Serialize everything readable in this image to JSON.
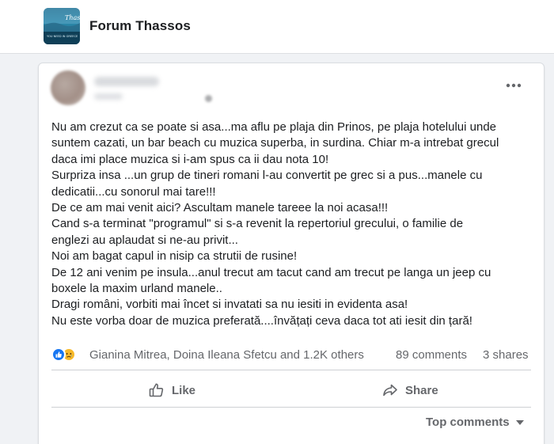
{
  "group": {
    "name": "Forum Thassos",
    "logo_caption": "YOU NEED IN GREECE",
    "logo_script": "Thassos"
  },
  "post": {
    "more_icon": "more-horizontal-icon",
    "lines": [
      "Nu am crezut ca se poate si asa...ma aflu pe plaja din Prinos, pe plaja hotelului unde",
      "suntem cazati, un bar beach cu muzica superba, in surdina. Chiar m-a intrebat grecul",
      "daca imi place muzica si i-am spus ca ii dau nota 10!",
      "Surpriza insa  ...un grup de tineri romani l-au convertit pe grec si a pus...manele cu",
      "dedicatii...cu sonorul mai tare!!!",
      "De ce am mai venit aici? Ascultam manele tareee la noi acasa!!!",
      "Cand s-a terminat \"programul\" si s-a revenit la repertoriul grecului, o familie de",
      "englezi au aplaudat si ne-au privit...",
      "Noi am bagat capul in nisip ca strutii de rusine!",
      "De 12 ani venim pe insula...anul trecut am tacut cand am trecut pe langa un jeep cu",
      "boxele la maxim urland manele..",
      "Dragi români, vorbiti mai încet si invatati sa nu iesiti in evidenta asa!",
      "Nu este vorba doar de muzica preferată....învățați ceva daca tot ati iesit din țară!"
    ],
    "reactions": {
      "names": "Gianina Mitrea, Doina Ileana Sfetcu and 1.2K others",
      "comments": "89 comments",
      "shares": "3 shares",
      "icons": [
        "like-reaction-icon",
        "sad-reaction-icon"
      ]
    },
    "actions": {
      "like": "Like",
      "share": "Share"
    },
    "sort_label": "Top comments"
  },
  "colors": {
    "page_bg": "#f0f2f5",
    "card_bg": "#ffffff",
    "secondary_text": "#65676b",
    "like_blue": "#1877f2",
    "sad_yellow": "#f7b928"
  }
}
